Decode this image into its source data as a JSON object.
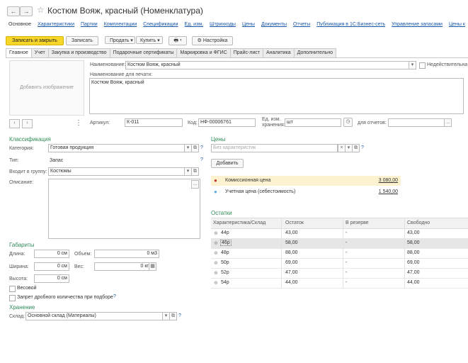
{
  "nav": {
    "back": "←",
    "forward": "→"
  },
  "window": {
    "title": "Костюм Вояж, красный (Номенклатура)"
  },
  "links": [
    "Основное",
    "Характеристики",
    "Партии",
    "Комплектации",
    "Спецификации",
    "Ед. изм.",
    "Штрихкоды",
    "Цены",
    "Документы",
    "Отчеты",
    "Публикация в 1С:Бизнес-сеть",
    "Управление запасами",
    "Цены к"
  ],
  "toolbar": {
    "save_close": "Записать и закрыть",
    "save": "Записать",
    "sell": "Продать",
    "buy": "Купить",
    "settings": "Настройка"
  },
  "tabs": [
    "Главное",
    "Учет",
    "Закупка и производство",
    "Подарочные сертификаты",
    "Маркировка и ФГИС",
    "Прайс-лист",
    "Аналитика",
    "Дополнительно"
  ],
  "image": {
    "add_label": "Добавить изображение"
  },
  "main": {
    "name_label": "Наименование:",
    "name_value": "Костюм Вояж, красный",
    "inactive_label": "Недействительна",
    "print_name_label": "Наименование для печати:",
    "print_name_value": "Костюм Вояж, красный",
    "article_label": "Артикул:",
    "article_value": "К-011",
    "code_label": "Код:",
    "code_value": "НФ-00006761",
    "unit_label": "Ед. изм. хранения:",
    "unit_value": "шт",
    "reports_label": "для отчетов:"
  },
  "classification": {
    "title": "Классификация",
    "category_label": "Категория:",
    "category_value": "Готовая продукция",
    "type_label": "Тип:",
    "type_value": "Запас",
    "group_label": "Входит в группу:",
    "group_value": "Костюмы",
    "description_label": "Описание:"
  },
  "dimensions": {
    "title": "Габариты",
    "length_label": "Длина:",
    "length_value": "0 см",
    "volume_label": "Объем:",
    "volume_value": "0 м3",
    "width_label": "Ширина:",
    "width_value": "0 см",
    "weight_label": "Вес:",
    "weight_value": "0 кг",
    "height_label": "Высота:",
    "height_value": "0 см",
    "weighted_label": "Весовой",
    "fraction_label": "Запрет дробного количества при подборе"
  },
  "storage": {
    "title": "Хранение",
    "warehouse_label": "Склад:",
    "warehouse_value": "Основной склад (Материалы)"
  },
  "prices": {
    "title": "Цены",
    "placeholder": "Без характеристик",
    "add_button": "Добавить",
    "rows": [
      {
        "name": "Комиссионная цена",
        "value": "3 080,00",
        "dot_color": "#c0392b"
      },
      {
        "name": "Учетная цена (себестоимость)",
        "value": "1 540,00",
        "dot_color": "#5dade2"
      }
    ]
  },
  "stock": {
    "title": "Остатки",
    "columns": [
      "Характеристика/Склад",
      "Остаток",
      "В резерве",
      "Свободно"
    ],
    "rows": [
      {
        "name": "44р",
        "balance": "43,00",
        "reserve": "-",
        "free": "43,00"
      },
      {
        "name": "46р",
        "balance": "58,00",
        "reserve": "-",
        "free": "58,00"
      },
      {
        "name": "48р",
        "balance": "88,00",
        "reserve": "-",
        "free": "88,00"
      },
      {
        "name": "50р",
        "balance": "69,00",
        "reserve": "-",
        "free": "69,00"
      },
      {
        "name": "52р",
        "balance": "47,00",
        "reserve": "-",
        "free": "47,00"
      },
      {
        "name": "54р",
        "balance": "44,00",
        "reserve": "-",
        "free": "44,00"
      }
    ]
  }
}
